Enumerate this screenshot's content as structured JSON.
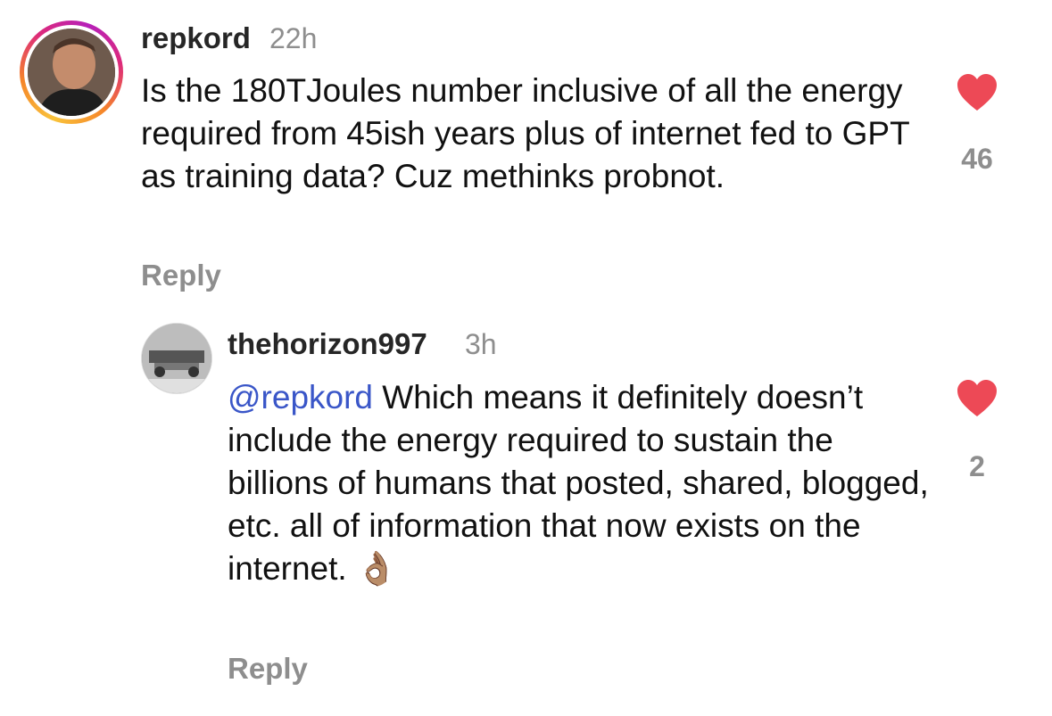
{
  "comments": [
    {
      "username": "repkord",
      "time": "22h",
      "text": "Is the 180TJoules number inclusive of all the energy required from 45ish years plus of internet fed to GPT as training data? Cuz methinks probnot.",
      "reply_label": "Reply",
      "like_count": "46",
      "has_story_ring": true
    },
    {
      "username": "thehorizon997",
      "time": "3h",
      "mention": "@repkord",
      "text": " Which means it definitely doesn’t include the energy required to sustain the billions of humans that posted, shared, blogged, etc. all of information that now exists on the internet.",
      "emoji": "👌🏽",
      "reply_label": "Reply",
      "like_count": "2"
    }
  ],
  "colors": {
    "like_heart": "#ed4956",
    "mention": "#3a56c8",
    "secondary_text": "#8e8e8e"
  },
  "icons": {
    "like": "heart-icon"
  }
}
